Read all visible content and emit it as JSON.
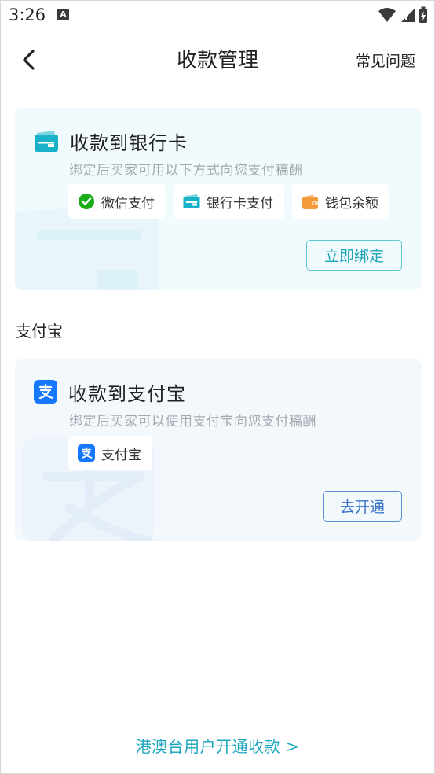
{
  "status_bar": {
    "time": "3:26",
    "notification_badge": "A"
  },
  "header": {
    "title": "收款管理",
    "faq_label": "常见问题"
  },
  "bank_card": {
    "title": "收款到银行卡",
    "description": "绑定后买家可用以下方式向您支付稿酬",
    "chips": [
      {
        "label": "微信支付",
        "icon": "wechat-pay-icon"
      },
      {
        "label": "银行卡支付",
        "icon": "bank-card-icon"
      },
      {
        "label": "钱包余额",
        "icon": "wallet-icon"
      }
    ],
    "button_label": "立即绑定"
  },
  "alipay_section": {
    "label": "支付宝",
    "title": "收款到支付宝",
    "description": "绑定后买家可以使用支付宝向您支付稿酬",
    "chip_label": "支付宝",
    "button_label": "去开通"
  },
  "footer": {
    "link_label": "港澳台用户开通收款 >"
  },
  "colors": {
    "teal_accent": "#1ea6b8",
    "blue_accent": "#3a74c9",
    "wechat_green": "#1aad19",
    "alipay_blue": "#1677ff",
    "wallet_orange": "#f39a3a"
  }
}
